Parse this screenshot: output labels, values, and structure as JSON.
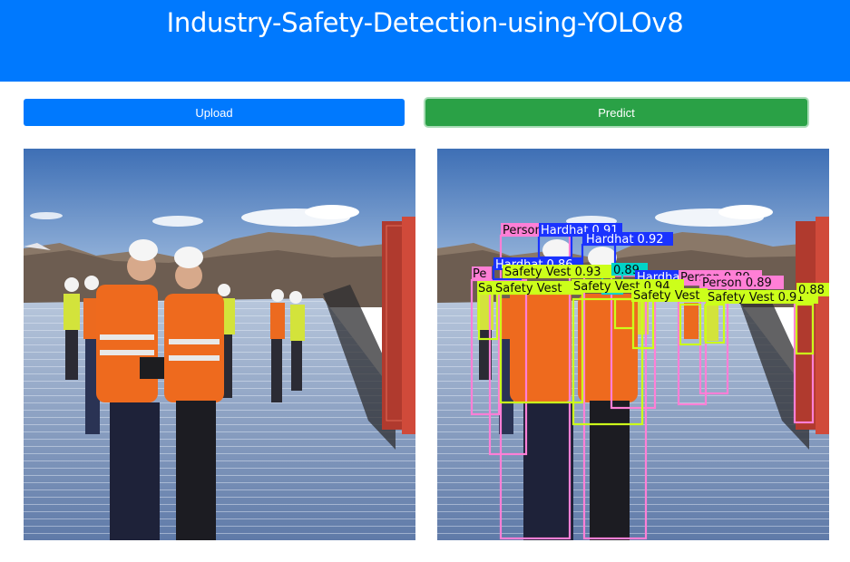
{
  "header": {
    "title": "Industry-Safety-Detection-using-YOLOv8"
  },
  "buttons": {
    "upload": "Upload",
    "predict": "Predict"
  },
  "colors": {
    "header_bg": "#0079fe",
    "upload_bg": "#0079fe",
    "predict_bg": "#2aa146",
    "person_box": "#ff7fd6",
    "hardhat_box": "#1a33ff",
    "vest_box": "#ccff1a",
    "other_box": "#00d4c8"
  },
  "detections": [
    {
      "label": "Person 0.91",
      "class": "person"
    },
    {
      "label": "Hardhat 0.91",
      "class": "hardhat"
    },
    {
      "label": "Hardhat 0.92",
      "class": "hardhat"
    },
    {
      "label": "Hardhat 0.86",
      "class": "hardhat"
    },
    {
      "label": "Pe",
      "class": "person"
    },
    {
      "label": "Safety Vest 0.93",
      "class": "vest"
    },
    {
      "label": "0.89",
      "class": "other"
    },
    {
      "label": "Hardhat",
      "class": "hardhat"
    },
    {
      "label": "Person 0.89",
      "class": "person"
    },
    {
      "label": "Person 0.89",
      "class": "person"
    },
    {
      "label": "Sa",
      "class": "vest"
    },
    {
      "label": "Safety Vest",
      "class": "vest"
    },
    {
      "label": "Safety Vest 0.94",
      "class": "vest"
    },
    {
      "label": "Safety Vest",
      "class": "vest"
    },
    {
      "label": "Safety Vest 0.91",
      "class": "vest"
    },
    {
      "label": "0.88",
      "class": "vest"
    }
  ]
}
